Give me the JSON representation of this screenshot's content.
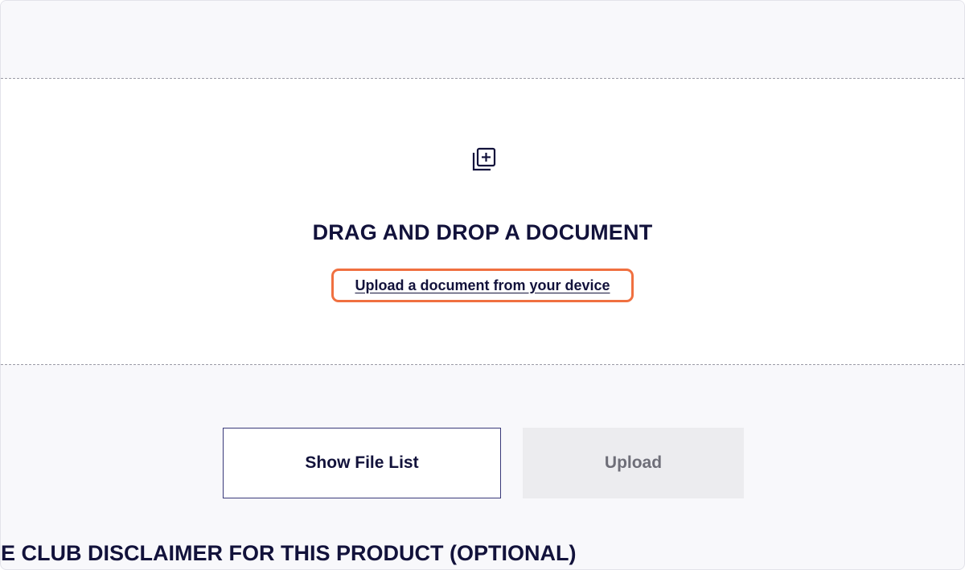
{
  "dropzone": {
    "icon": "add-document-icon",
    "title": "DRAG AND DROP A DOCUMENT",
    "upload_link": "Upload a document from your device"
  },
  "actions": {
    "show_file_list": "Show File List",
    "upload": "Upload"
  },
  "disclaimer_heading": "E CLUB DISCLAIMER FOR THIS PRODUCT (OPTIONAL)",
  "colors": {
    "text_primary": "#12123b",
    "highlight": "#f07040",
    "disabled_bg": "#ececef",
    "disabled_text": "#6e6e78"
  }
}
